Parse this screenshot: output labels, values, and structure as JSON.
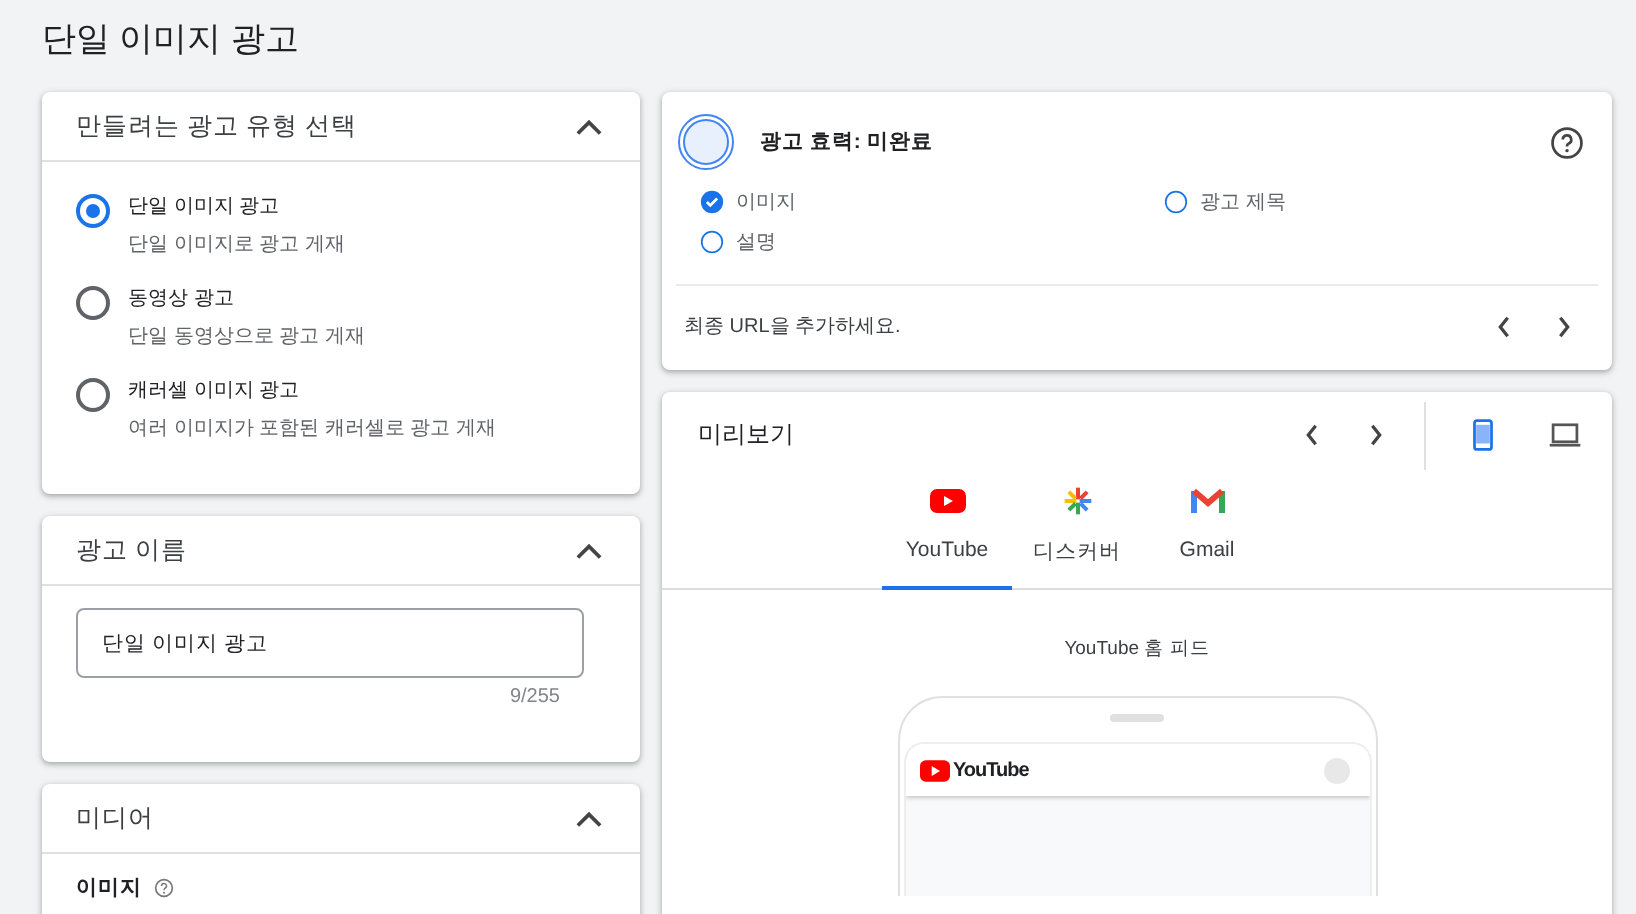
{
  "page_title": "단일 이미지 광고",
  "ad_type_card": {
    "title": "만들려는 광고 유형 선택",
    "expanded": true,
    "options": [
      {
        "label": "단일 이미지 광고",
        "description": "단일 이미지로 광고 게재",
        "selected": true
      },
      {
        "label": "동영상 광고",
        "description": "단일 동영상으로 광고 게재",
        "selected": false
      },
      {
        "label": "캐러셀 이미지 광고",
        "description": "여러 이미지가 포함된 캐러셀로 광고 게재",
        "selected": false
      }
    ]
  },
  "ad_name_card": {
    "title": "광고 이름",
    "expanded": true,
    "value": "단일 이미지 광고",
    "counter": "9/255"
  },
  "media_card": {
    "title": "미디어",
    "expanded": true,
    "section_label": "이미지"
  },
  "strength_card": {
    "title": "광고 효력: 미완료",
    "checklist": [
      {
        "label": "이미지",
        "checked": true
      },
      {
        "label": "광고 제목",
        "checked": false
      },
      {
        "label": "설명",
        "checked": false
      }
    ],
    "tip": "최종 URL을 추가하세요."
  },
  "preview_card": {
    "title": "미리보기",
    "devices": [
      {
        "kind": "mobile",
        "selected": true
      },
      {
        "kind": "desktop",
        "selected": false
      }
    ],
    "tabs": [
      {
        "kind": "youtube",
        "label": "YouTube",
        "selected": true
      },
      {
        "kind": "discover",
        "label": "디스커버",
        "selected": false
      },
      {
        "kind": "gmail",
        "label": "Gmail",
        "selected": false
      }
    ],
    "placement": "YouTube 홈 피드",
    "mock_logo": "YouTube"
  }
}
